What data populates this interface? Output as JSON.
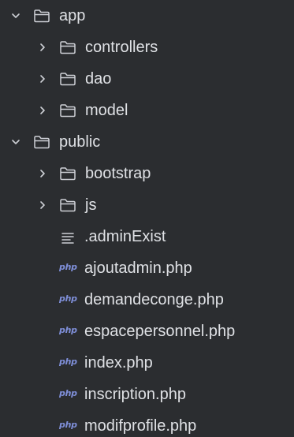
{
  "tree": [
    {
      "label": "app",
      "type": "folder",
      "expanded": true,
      "depth": 0
    },
    {
      "label": "controllers",
      "type": "folder",
      "expanded": false,
      "depth": 1
    },
    {
      "label": "dao",
      "type": "folder",
      "expanded": false,
      "depth": 1
    },
    {
      "label": "model",
      "type": "folder",
      "expanded": false,
      "depth": 1
    },
    {
      "label": "public",
      "type": "folder",
      "expanded": true,
      "depth": 0
    },
    {
      "label": "bootstrap",
      "type": "folder",
      "expanded": false,
      "depth": 1
    },
    {
      "label": "js",
      "type": "folder",
      "expanded": false,
      "depth": 1
    },
    {
      "label": ".adminExist",
      "type": "text-file",
      "depth": 1
    },
    {
      "label": "ajoutadmin.php",
      "type": "php-file",
      "depth": 1
    },
    {
      "label": "demandeconge.php",
      "type": "php-file",
      "depth": 1
    },
    {
      "label": "espacepersonnel.php",
      "type": "php-file",
      "depth": 1
    },
    {
      "label": "index.php",
      "type": "php-file",
      "depth": 1
    },
    {
      "label": "inscription.php",
      "type": "php-file",
      "depth": 1
    },
    {
      "label": "modifprofile.php",
      "type": "php-file",
      "depth": 1
    }
  ],
  "icons": {
    "php_badge": "php"
  },
  "colors": {
    "background": "#2b2d30",
    "text": "#dfe1e5",
    "icon": "#ced0d6",
    "php_badge": "#7f8fd9"
  }
}
